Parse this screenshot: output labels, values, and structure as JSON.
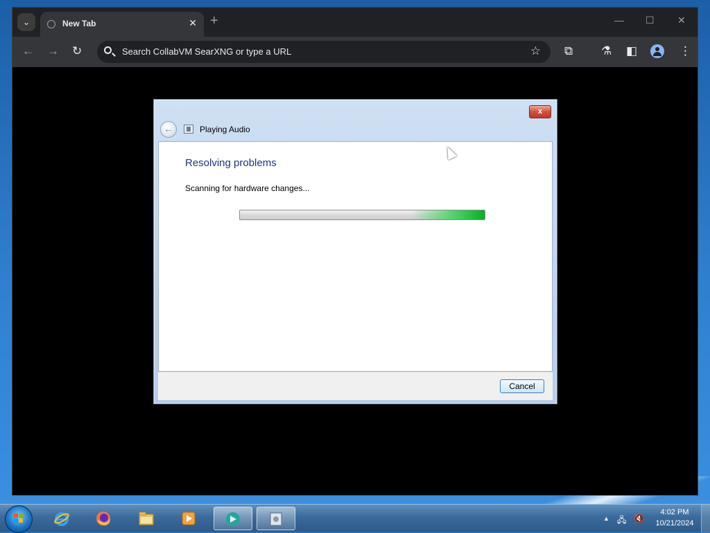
{
  "browser": {
    "tab_title": "New Tab",
    "tab_close": "✕",
    "new_tab": "+",
    "window_minimize": "—",
    "window_maximize": "☐",
    "window_close": "✕",
    "omnibox_placeholder": "Search CollabVM SearXNG or type a URL",
    "icons": [
      "tab-search-icon",
      "back-icon",
      "forward-icon",
      "reload-icon",
      "search-icon",
      "bookmark-star-icon",
      "extensions-icon",
      "labs-flask-icon",
      "side-panel-icon",
      "profile-icon",
      "menu-dots-icon"
    ]
  },
  "dialog": {
    "title": "Playing Audio",
    "close_label": "x",
    "heading": "Resolving problems",
    "status": "Scanning for hardware changes...",
    "progress_mode": "indeterminate",
    "cancel_label": "Cancel"
  },
  "taskbar": {
    "apps": [
      "internet-explorer",
      "firefox",
      "file-explorer",
      "media-player",
      "collabvm-app",
      "troubleshooter-window"
    ],
    "time": "4:02 PM",
    "date": "10/21/2024",
    "tray_icons": [
      "show-hidden-icons",
      "network-icon",
      "volume-muted-icon"
    ]
  },
  "colors": {
    "dialog_heading": "#1e3287",
    "progress_green": "#06b025",
    "browser_bg": "#202124"
  }
}
